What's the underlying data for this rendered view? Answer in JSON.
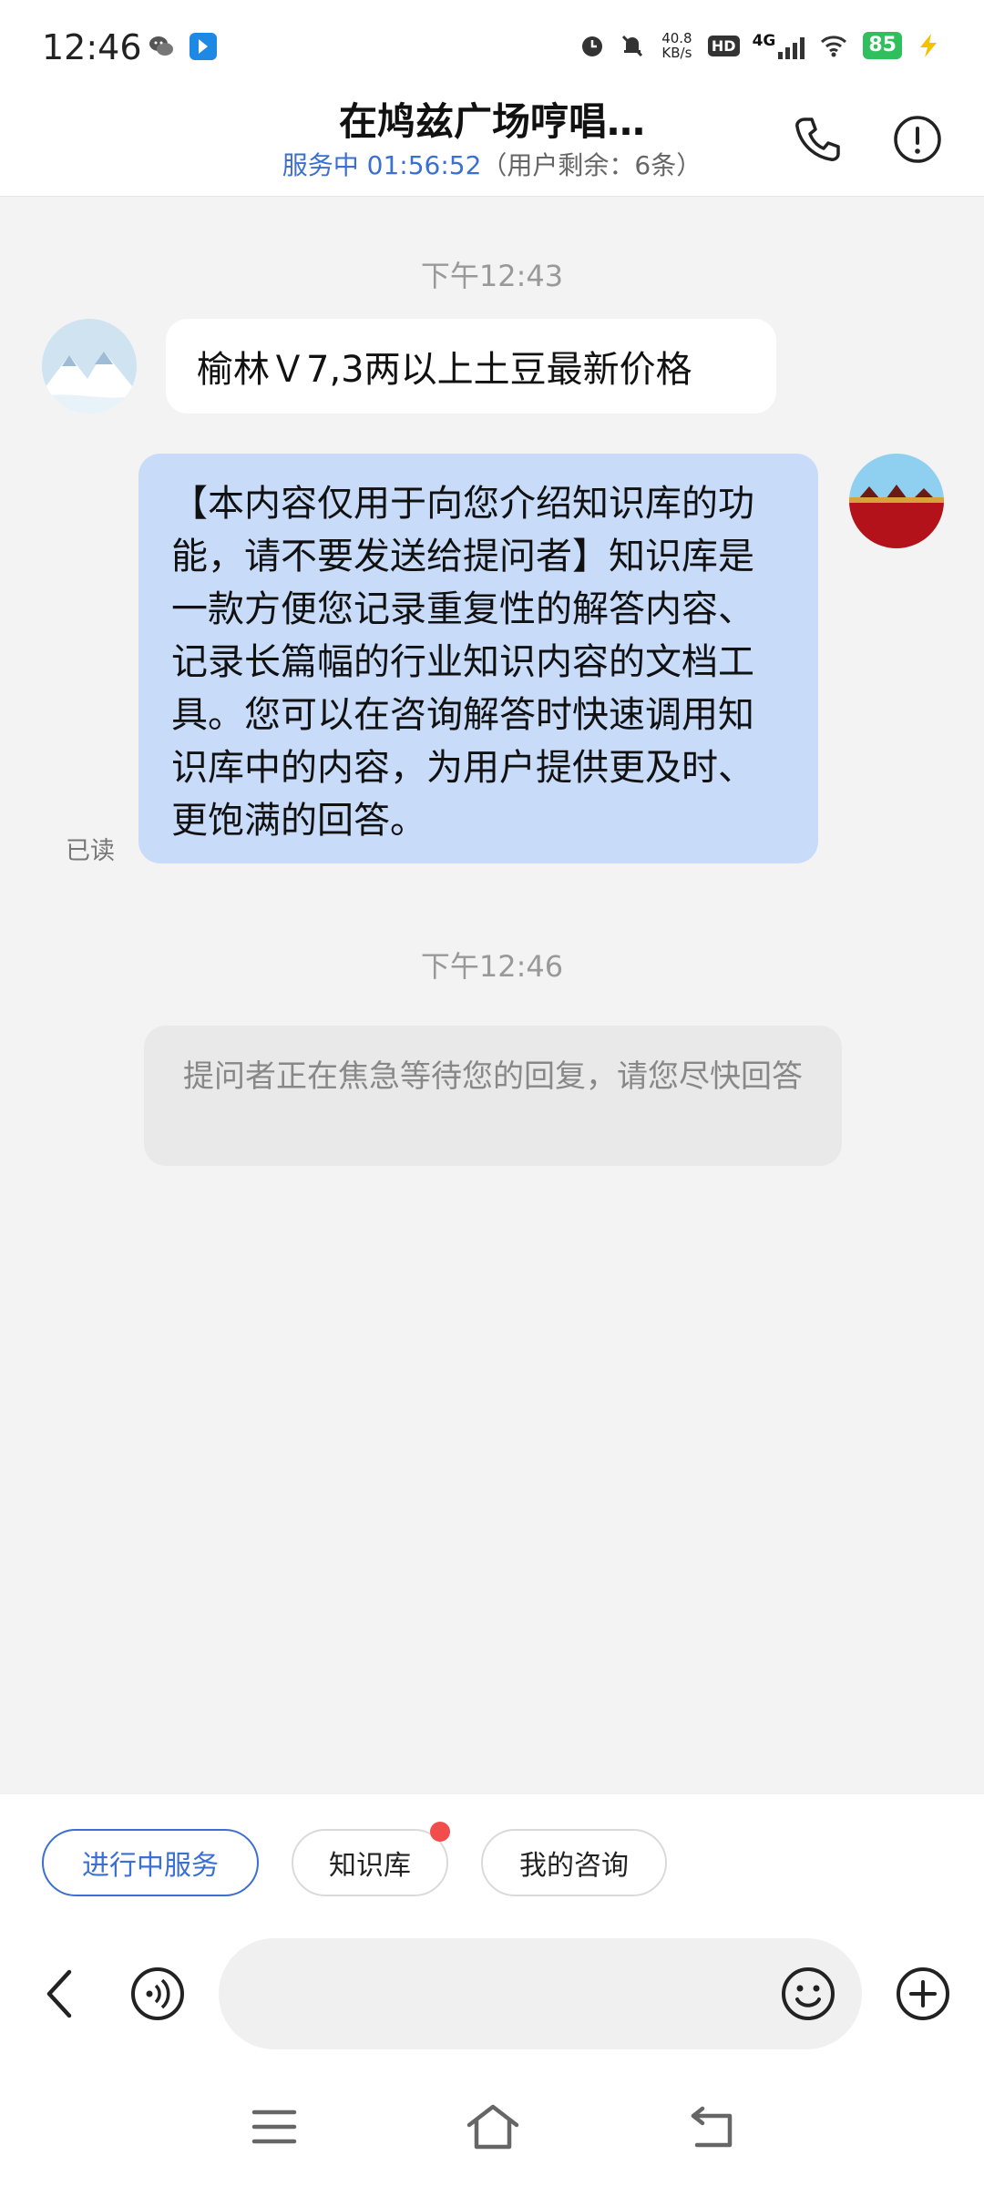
{
  "status_bar": {
    "time": "12:46",
    "net_speed_value": "40.8",
    "net_speed_unit": "KB/s",
    "hd_label": "HD",
    "network": "4G",
    "battery": "85"
  },
  "header": {
    "title": "在鸠兹广场哼唱…",
    "service_status": "服务中 01:56:52",
    "remaining": "（用户剩余：6条）"
  },
  "chat": {
    "messages": [
      {
        "time": "下午12:43",
        "direction": "incoming",
        "text": "榆林Ｖ7,3两以上土豆最新价格"
      },
      {
        "direction": "outgoing",
        "text": "【本内容仅用于向您介绍知识库的功能，请不要发送给提问者】知识库是一款方便您记录重复性的解答内容、记录长篇幅的行业知识内容的文档工具。您可以在咨询解答时快速调用知识库中的内容，为用户提供更及时、更饱满的回答。",
        "status": "已读"
      },
      {
        "time": "下午12:46",
        "direction": "system",
        "text": "提问者正在焦急等待您的回复，请您尽快回答"
      }
    ]
  },
  "quick_actions": [
    {
      "label": "进行中服务",
      "active": true,
      "badge": false
    },
    {
      "label": "知识库",
      "active": false,
      "badge": true
    },
    {
      "label": "我的咨询",
      "active": false,
      "badge": false
    }
  ],
  "composer": {
    "placeholder": ""
  },
  "colors": {
    "accent": "#3b6fd1",
    "outgoing_bubble": "#c8dcfa",
    "incoming_bubble": "#ffffff",
    "badge": "#f24c4c",
    "battery": "#2fbf5c"
  },
  "icons": [
    "wechat-icon",
    "app-notification-icon",
    "alarm-icon",
    "mute-icon",
    "signal-icon",
    "wifi-icon",
    "charging-icon",
    "phone-icon",
    "info-icon",
    "back-icon",
    "voice-icon",
    "emoji-icon",
    "plus-icon",
    "menu-icon",
    "home-icon",
    "return-icon"
  ]
}
